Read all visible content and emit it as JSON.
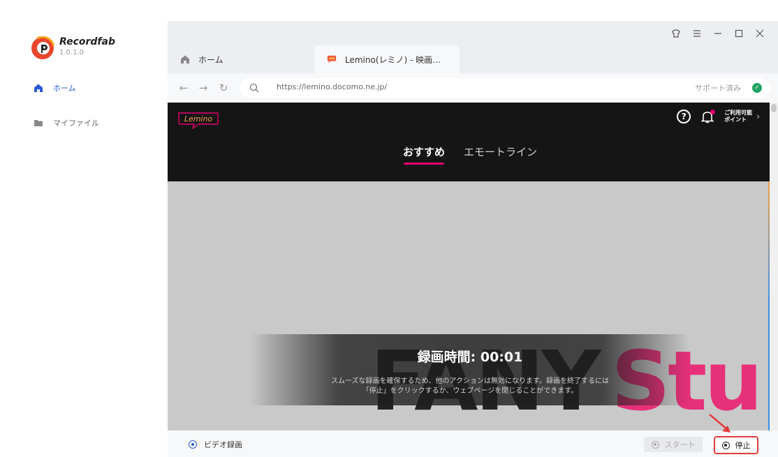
{
  "sidebar": {
    "brand": "Recordfab",
    "version": "1.0.1.0",
    "items": [
      {
        "label": "ホーム",
        "icon": "home-icon",
        "active": true
      },
      {
        "label": "マイファイル",
        "icon": "folder-icon",
        "active": false
      }
    ]
  },
  "tabs": [
    {
      "label": "ホーム",
      "icon": "home-icon"
    },
    {
      "label": "Lemino(レミノ) - 映画…",
      "icon": "lemino-favicon-icon"
    }
  ],
  "addressbar": {
    "url": "https://lemino.docomo.ne.jp/",
    "support_status": "サポート済み"
  },
  "site": {
    "logo_text": "Lemino",
    "points_label_line1": "ご利用可能",
    "points_label_line2": "ポイント",
    "tabs": [
      "おすすめ",
      "エモートライン"
    ],
    "background_art_text_1": "FANY",
    "background_art_text_2": "Stu"
  },
  "recording": {
    "time_label": "録画時間: 00:01",
    "note_line1": "スムーズな録画を確保するため、他のアクションは無効になります。録画を終了するには",
    "note_line2": "「停止」をクリックするか、ウェブページを閉じることができます。"
  },
  "bottombar": {
    "mode_label": "ビデオ録画",
    "start_label": "スタート",
    "stop_label": "停止"
  },
  "colors": {
    "accent": "#2b5ad6",
    "lemino_pink": "#e5006e",
    "support_green": "#1fa463",
    "highlight_red": "#e33c3c"
  }
}
